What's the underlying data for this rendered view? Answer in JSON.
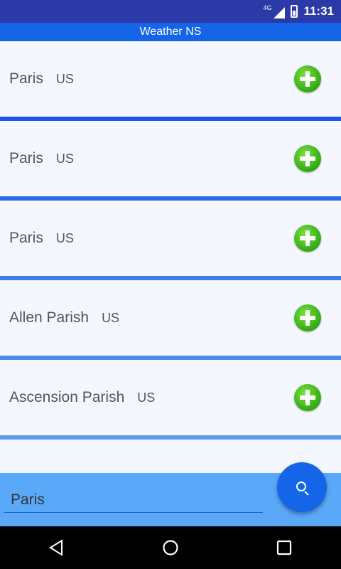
{
  "status_bar": {
    "network": "4G",
    "time": "11:31"
  },
  "app": {
    "title": "Weather NS"
  },
  "results": [
    {
      "city": "Paris",
      "country": "US"
    },
    {
      "city": "Paris",
      "country": "US"
    },
    {
      "city": "Paris",
      "country": "US"
    },
    {
      "city": "Allen Parish",
      "country": "US"
    },
    {
      "city": "Ascension Parish",
      "country": "US"
    }
  ],
  "separator_colors": [
    "#1c57e6",
    "#2d6ae8",
    "#3a7ce9",
    "#4b8cec",
    "#5a9cee"
  ],
  "add_button_color": "#39b21a",
  "search": {
    "value": "Paris"
  },
  "colors": {
    "status_bar": "#2b3aa6",
    "app_bar": "#1565e8",
    "search_panel": "#5aa8f8",
    "fab": "#1565e8"
  }
}
